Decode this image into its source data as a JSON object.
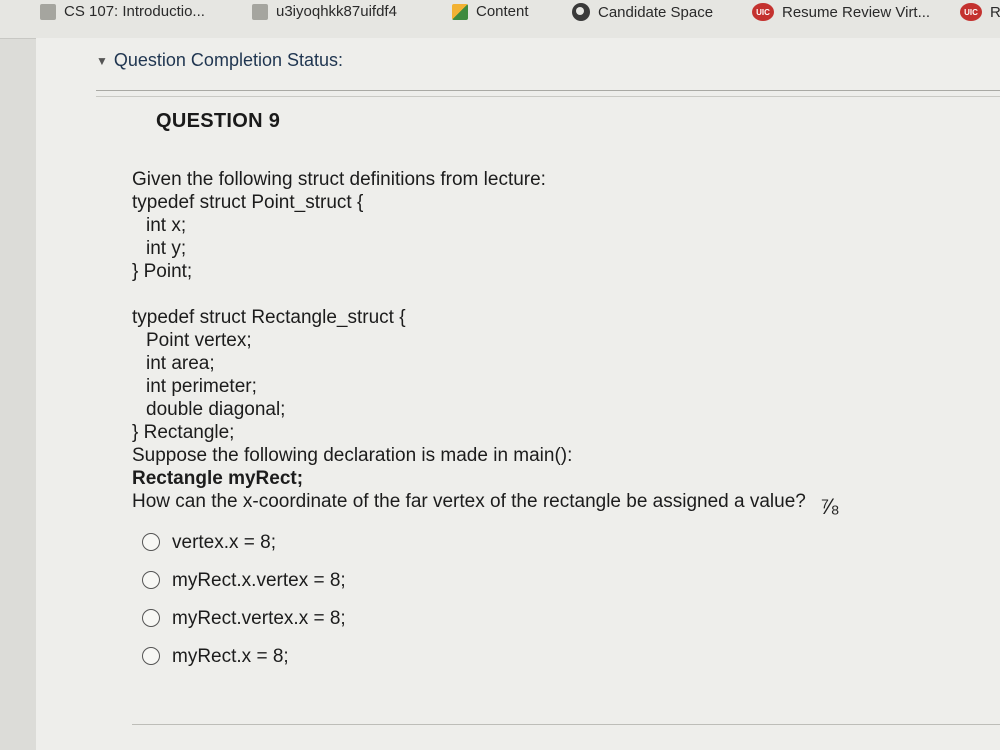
{
  "bookmarks": [
    {
      "label": "CS 107: Introductio...",
      "icon": "doc-icon"
    },
    {
      "label": "u3iyoqhkk87uifdf4",
      "icon": "doc-icon"
    },
    {
      "label": "Content",
      "icon": "content-icon"
    },
    {
      "label": "Candidate Space",
      "icon": "globe-icon"
    },
    {
      "label": "Resume Review Virt...",
      "icon": "uic-icon"
    },
    {
      "label": "R",
      "icon": "uic-icon"
    }
  ],
  "uic_badge": "UIC",
  "status": {
    "label": "Question Completion Status:"
  },
  "question": {
    "title": "QUESTION 9",
    "lines": [
      "Given the following struct definitions from lecture:",
      "typedef struct Point_struct {",
      "int x;",
      "int y;",
      "} Point;",
      "typedef struct Rectangle_struct {",
      "Point vertex;",
      "int area;",
      "int perimeter;",
      "double diagonal;",
      "} Rectangle;",
      "Suppose the following declaration is made in main():",
      "Rectangle myRect;",
      "How can the x-coordinate of the far vertex of the rectangle be assigned a value?"
    ],
    "options": [
      "vertex.x = 8;",
      "myRect.x.vertex = 8;",
      "myRect.vertex.x = 8;",
      "myRect.x = 8;"
    ]
  }
}
